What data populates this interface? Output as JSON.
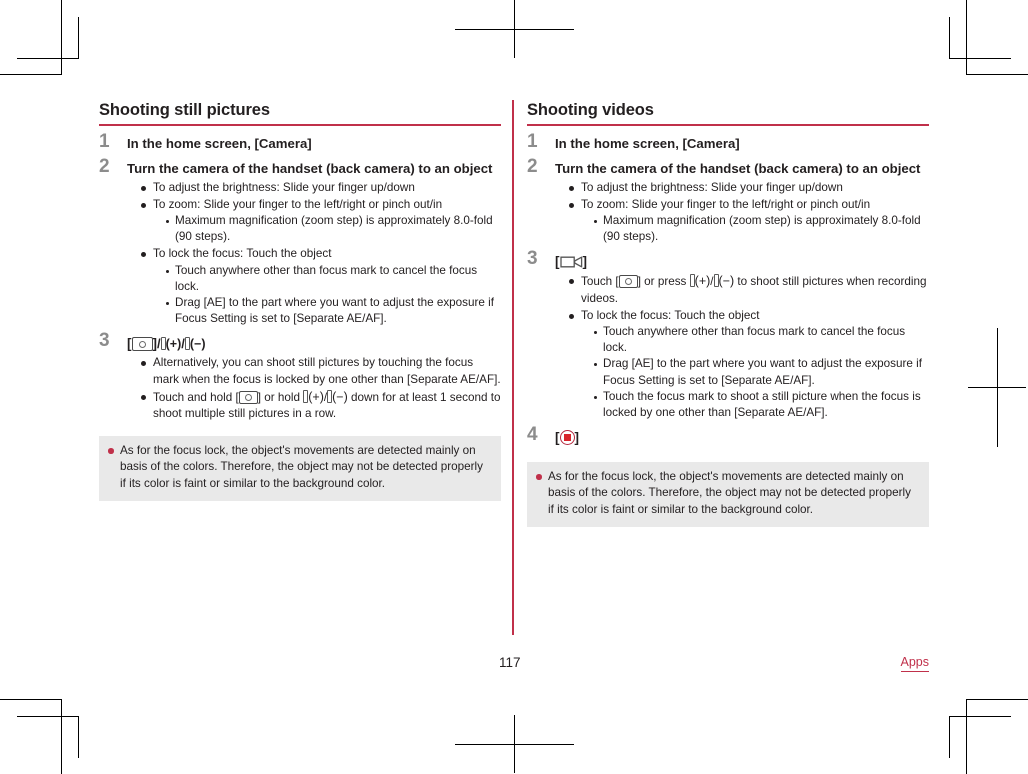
{
  "footer": {
    "page_number": "117",
    "section_tag": "Apps"
  },
  "colors": {
    "accent_red": "#c0304a",
    "record_red": "#d8232a",
    "note_background": "#e9e9e9",
    "step_number_gray": "#8c8c8c",
    "text": "#231f20"
  },
  "left_column": {
    "title": "Shooting still pictures",
    "steps": [
      {
        "number": "1",
        "heading": "In the home screen, [Camera]"
      },
      {
        "number": "2",
        "heading": "Turn the camera of the handset (back camera) to an object",
        "bullets": [
          {
            "text": "To adjust the brightness: Slide your finger up/down"
          },
          {
            "text": "To zoom: Slide your finger to the left/right or pinch out/in",
            "sub": [
              "Maximum magnification (zoom step) is approximately 8.0-fold (90 steps)."
            ]
          },
          {
            "text": "To lock the focus: Touch the object",
            "sub": [
              "Touch anywhere other than focus mark to cancel the focus lock.",
              "Drag [AE] to the part where you want to adjust the exposure if Focus Setting is set to [Separate AE/AF]."
            ]
          }
        ]
      },
      {
        "number": "3",
        "heading_icons": {
          "open_bracket": "[",
          "shutter_icon": "camera-shutter-icon",
          "close_bracket": "]",
          "separator": "/",
          "volume_up_icon": "volume-up-key-icon",
          "volume_up_sign": "(+)",
          "volume_down_icon": "volume-down-key-icon",
          "volume_down_sign": "(−)"
        },
        "bullets": [
          {
            "text": "Alternatively, you can shoot still pictures by touching the focus mark when the focus is locked by one other than [Separate AE/AF]."
          },
          {
            "rich": true,
            "pre": "Touch and hold [",
            "mid": "] or hold ",
            "post": " down for at least 1 second to shoot multiple still pictures in a row."
          }
        ]
      }
    ],
    "note": "As for the focus lock, the object's movements are detected mainly on basis of the colors. Therefore, the object may not be detected properly if its color is faint or similar to the background color."
  },
  "right_column": {
    "title": "Shooting videos",
    "steps": [
      {
        "number": "1",
        "heading": "In the home screen, [Camera]"
      },
      {
        "number": "2",
        "heading": "Turn the camera of the handset (back camera) to an object",
        "bullets": [
          {
            "text": "To adjust the brightness: Slide your finger up/down"
          },
          {
            "text": "To zoom: Slide your finger to the left/right or pinch out/in",
            "sub": [
              "Maximum magnification (zoom step) is approximately 8.0-fold (90 steps)."
            ]
          }
        ]
      },
      {
        "number": "3",
        "heading_icons": {
          "open_bracket": "[",
          "camcorder_icon": "video-camera-icon",
          "close_bracket": "]"
        },
        "bullets": [
          {
            "rich": true,
            "pre": "Touch [",
            "mid": "] or press ",
            "post": " to shoot still pictures when recording videos."
          },
          {
            "text": "To lock the focus: Touch the object",
            "sub": [
              "Touch anywhere other than focus mark to cancel the focus lock.",
              "Drag [AE] to the part where you want to adjust the exposure if Focus Setting is set to [Separate AE/AF].",
              "Touch the focus mark to shoot a still picture when the focus is locked by one other than [Separate AE/AF]."
            ]
          }
        ]
      },
      {
        "number": "4",
        "heading_icons": {
          "open_bracket": "[",
          "stop_icon": "record-stop-icon",
          "close_bracket": "]"
        }
      }
    ],
    "note": "As for the focus lock, the object's movements are detected mainly on basis of the colors. Therefore, the object may not be detected properly if its color is faint or similar to the background color."
  },
  "icon_glyphs": {
    "volume_up_sign": "(+)",
    "volume_down_sign": "(−)",
    "slash": "/"
  }
}
